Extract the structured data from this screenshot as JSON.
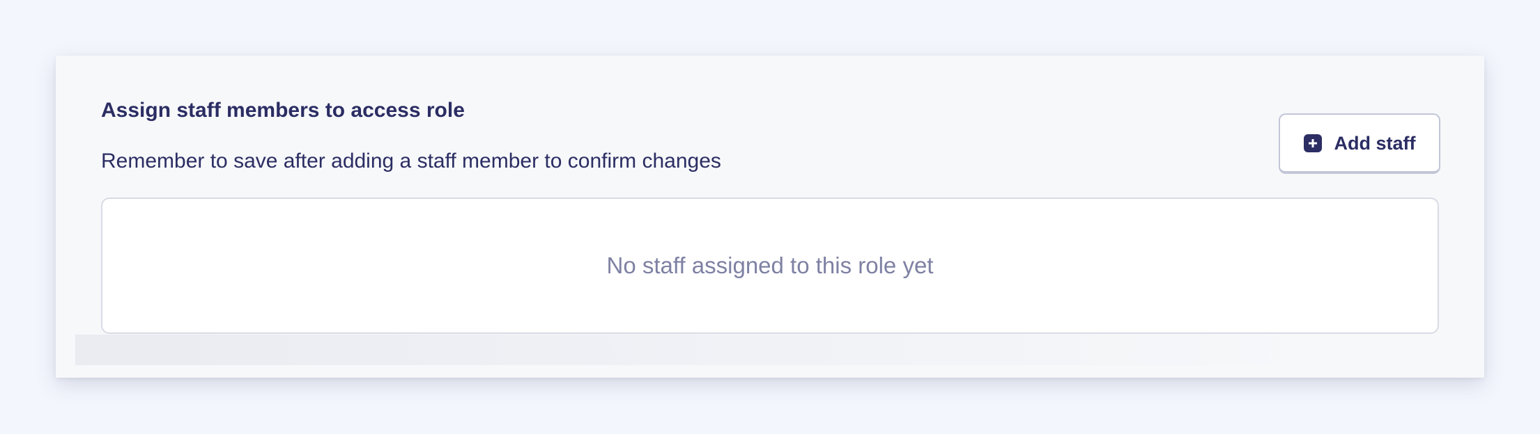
{
  "section": {
    "title": "Assign staff members to access role",
    "subtitle": "Remember to save after adding a staff member to confirm changes"
  },
  "actions": {
    "add_staff_label": "Add staff",
    "add_staff_icon": "plus-square-icon"
  },
  "staff_list": {
    "items": [],
    "empty_message": "No staff assigned to this role yet"
  },
  "colors": {
    "page_background": "#f3f6fd",
    "card_background": "#f7f8fa",
    "primary_text": "#2b2d63",
    "muted_text": "#7e81a3",
    "border": "#d9dbe5"
  }
}
